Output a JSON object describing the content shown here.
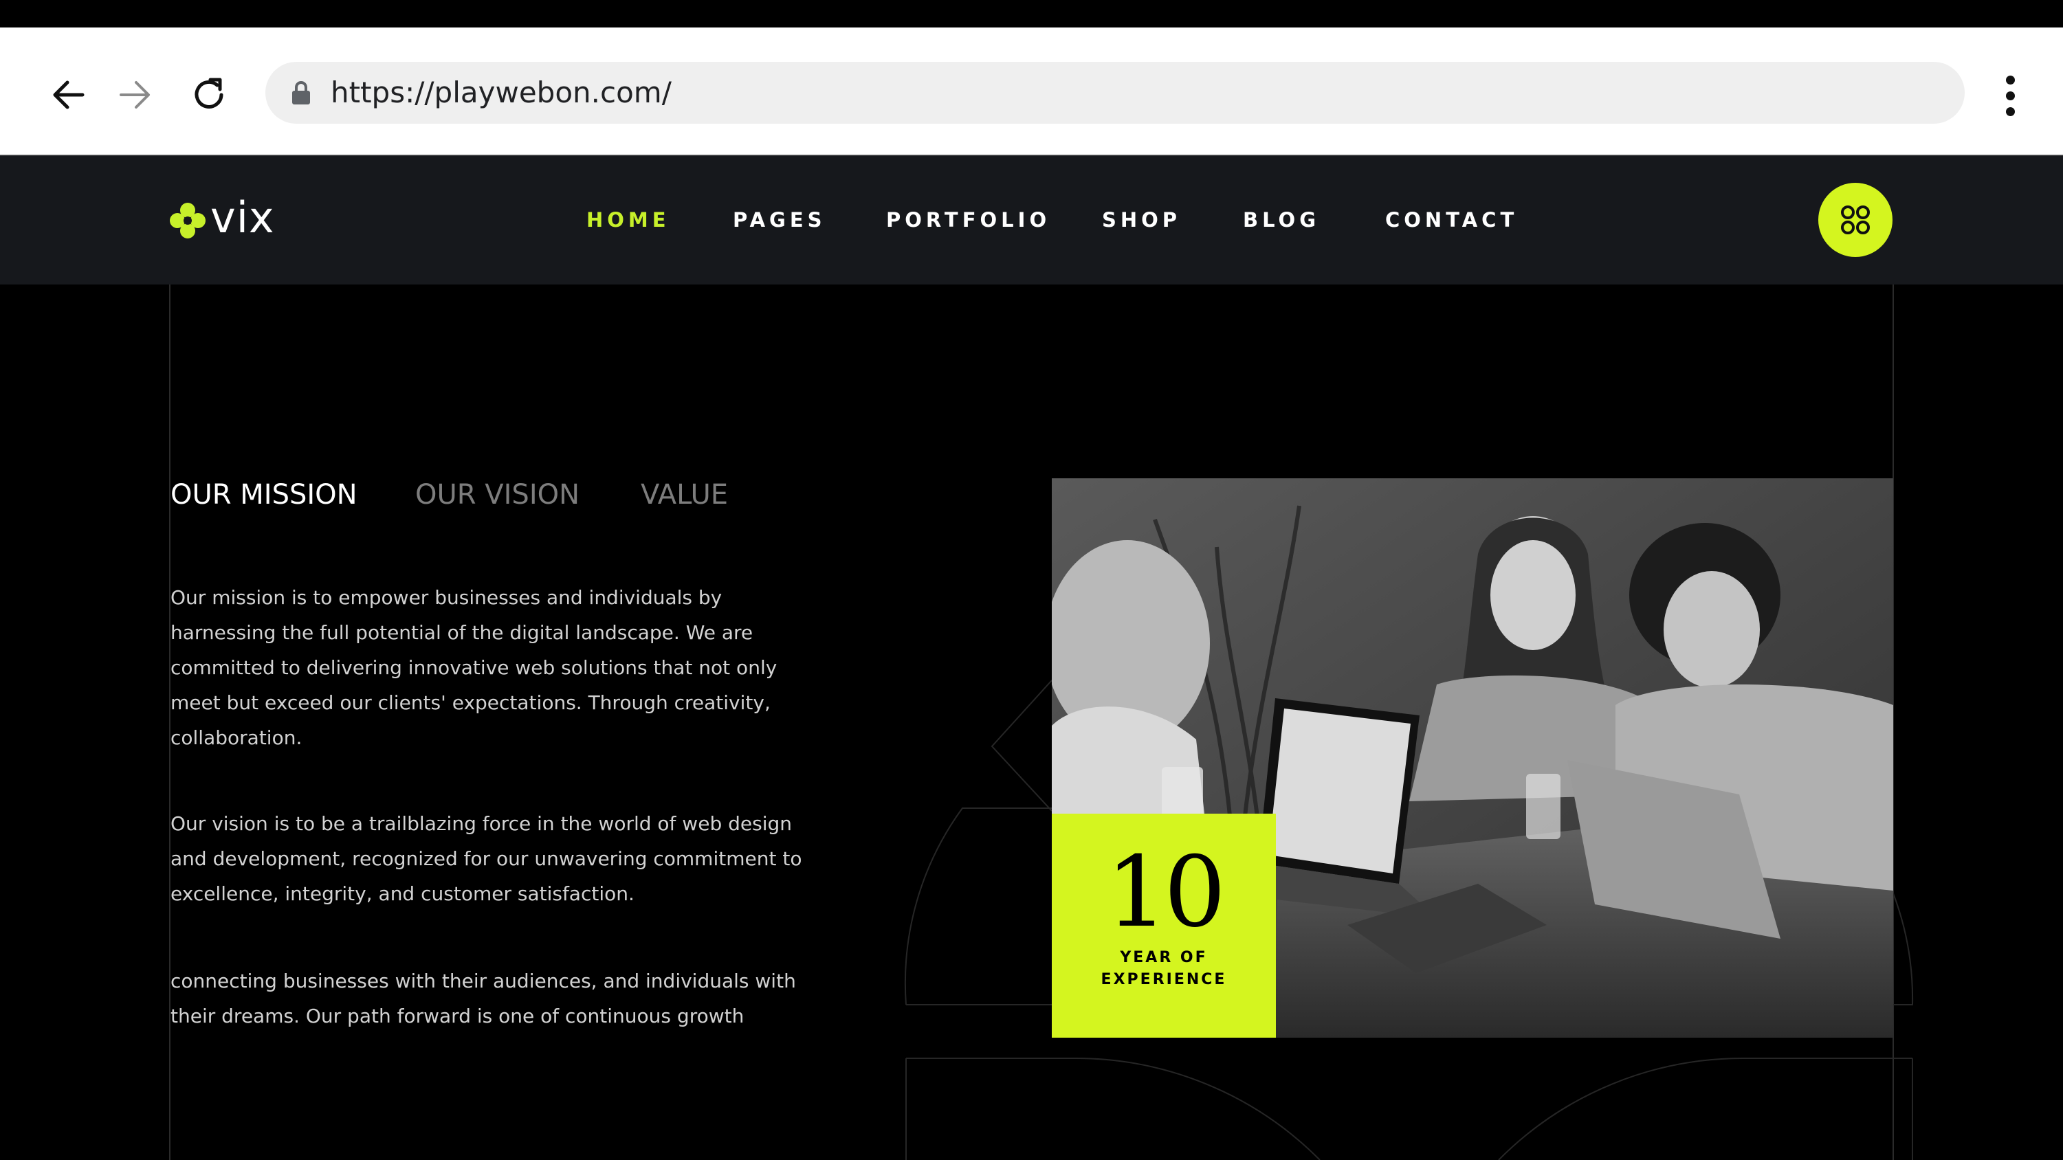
{
  "browser": {
    "url": "https://playwebon.com/"
  },
  "site": {
    "logo_text": "vix",
    "nav": [
      {
        "label": "HOME",
        "active": true
      },
      {
        "label": "PAGES",
        "active": false
      },
      {
        "label": "PORTFOLIO",
        "active": false
      },
      {
        "label": "SHOP",
        "active": false
      },
      {
        "label": "BLOG",
        "active": false
      },
      {
        "label": "CONTACT",
        "active": false
      }
    ],
    "accent_color": "#d4f51f"
  },
  "content": {
    "tabs": [
      {
        "label": "OUR MISSION",
        "active": true
      },
      {
        "label": "OUR VISION",
        "active": false
      },
      {
        "label": "VALUE",
        "active": false
      }
    ],
    "paragraphs": [
      "Our mission is to empower businesses and individuals by harnessing the full potential of the digital landscape. We are committed to delivering innovative web solutions that not only meet but exceed our clients' expectations. Through creativity, collaboration.",
      "Our vision is to be a trailblazing force in the world of web design and development, recognized for our unwavering commitment to excellence, integrity, and customer satisfaction.",
      "connecting businesses with their audiences, and individuals with their dreams. Our path forward is one of continuous growth"
    ],
    "experience": {
      "number": "10",
      "label_line1": "YEAR OF",
      "label_line2": "EXPERIENCE"
    }
  }
}
